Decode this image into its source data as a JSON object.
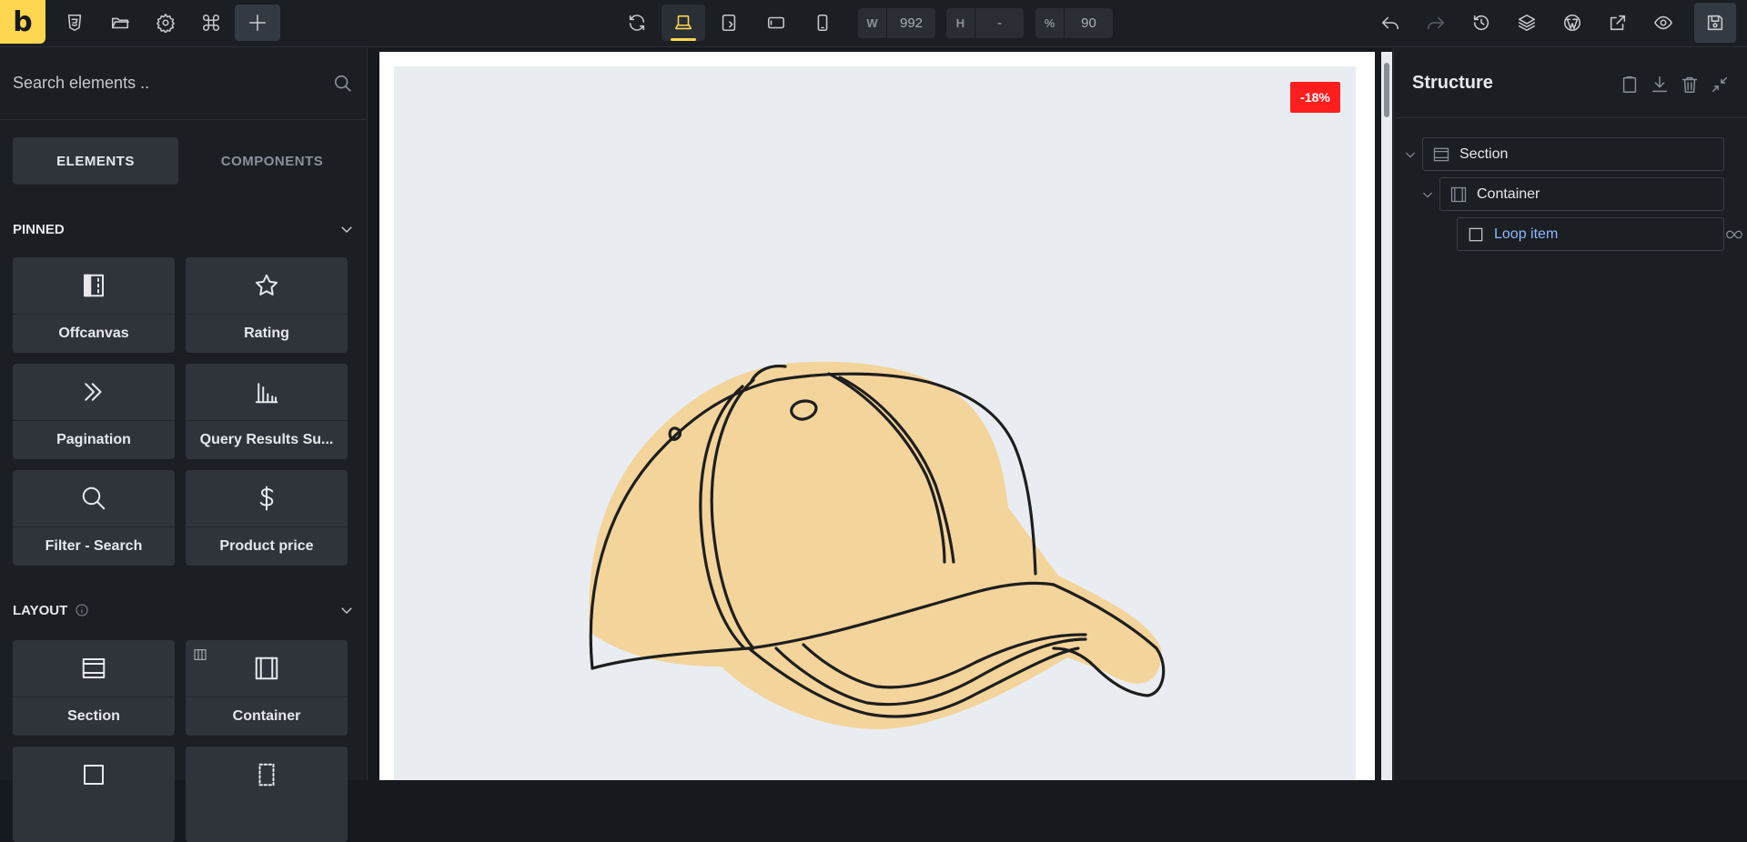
{
  "toolbar": {
    "logo_letter": "b",
    "width_label": "W",
    "width_value": "992",
    "height_label": "H",
    "height_value": "-",
    "zoom_label": "%",
    "zoom_value": "90"
  },
  "left_panel": {
    "search_placeholder": "Search elements ..",
    "tabs": [
      "ELEMENTS",
      "COMPONENTS"
    ],
    "pinned_title": "PINNED",
    "pinned_items": [
      {
        "label": "Offcanvas",
        "icon": "offcanvas-icon"
      },
      {
        "label": "Rating",
        "icon": "star-icon"
      },
      {
        "label": "Pagination",
        "icon": "double-chevron-icon"
      },
      {
        "label": "Query Results Su...",
        "icon": "bar-chart-icon"
      },
      {
        "label": "Filter - Search",
        "icon": "search-icon"
      },
      {
        "label": "Product price",
        "icon": "dollar-icon"
      }
    ],
    "layout_title": "LAYOUT",
    "layout_items": [
      {
        "label": "Section",
        "icon": "section-icon"
      },
      {
        "label": "Container",
        "icon": "container-icon"
      }
    ]
  },
  "canvas": {
    "discount_badge": "-18%"
  },
  "structure": {
    "title": "Structure",
    "items": [
      {
        "label": "Section"
      },
      {
        "label": "Container"
      },
      {
        "label": "Loop item"
      }
    ]
  },
  "colors": {
    "accent": "#ffd64f",
    "badge": "#ff1e1e",
    "loop_item": "#8fb7ff"
  }
}
